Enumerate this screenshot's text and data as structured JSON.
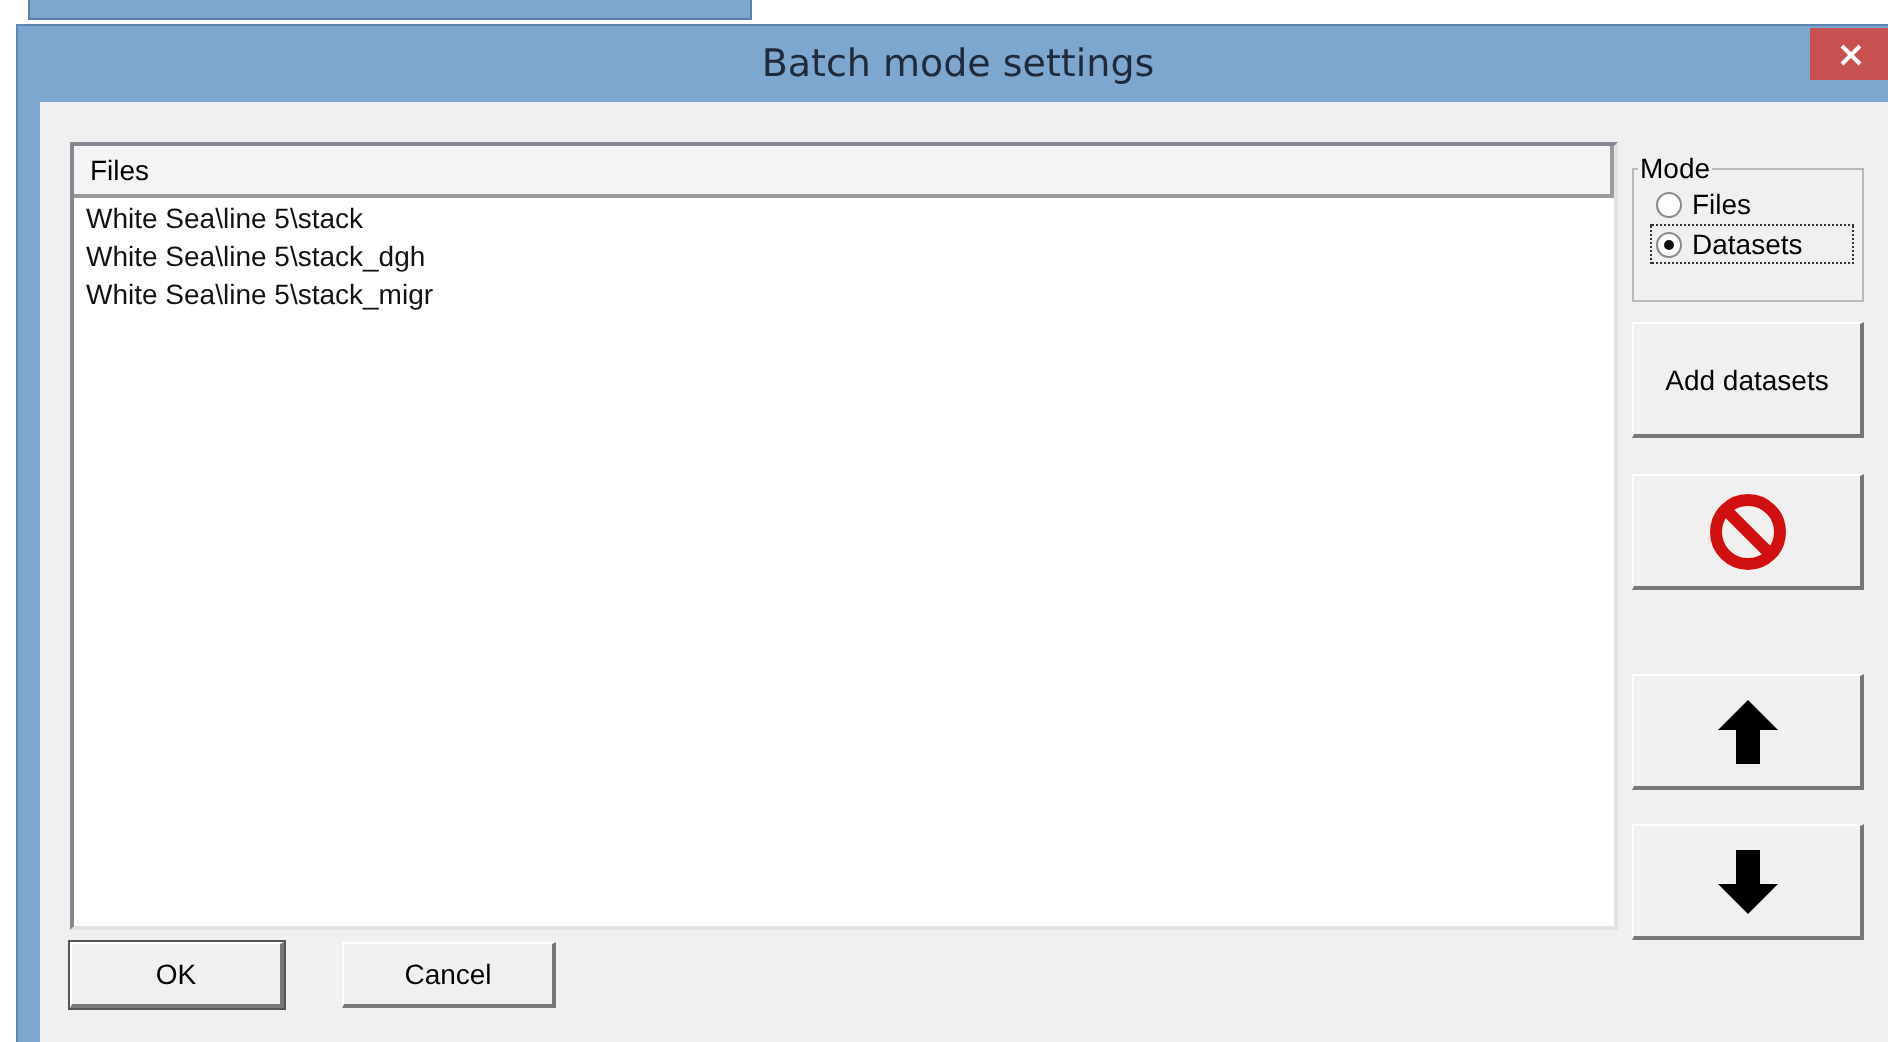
{
  "window": {
    "title": "Batch mode settings"
  },
  "list": {
    "header": "Files",
    "rows": [
      {
        "text": "White Sea\\line 5\\stack"
      },
      {
        "text": "White Sea\\line 5\\stack_dgh"
      },
      {
        "text": "White Sea\\line 5\\stack_migr"
      }
    ]
  },
  "mode": {
    "label": "Mode",
    "options": [
      {
        "label": "Files",
        "selected": false
      },
      {
        "label": "Datasets",
        "selected": true
      }
    ]
  },
  "side_buttons": [
    {
      "kind": "text",
      "label": "Add datasets"
    },
    {
      "kind": "delete"
    },
    {
      "kind": "up"
    },
    {
      "kind": "down"
    }
  ],
  "buttons": [
    {
      "label": "OK",
      "default": true
    },
    {
      "label": "Cancel",
      "default": false
    }
  ]
}
